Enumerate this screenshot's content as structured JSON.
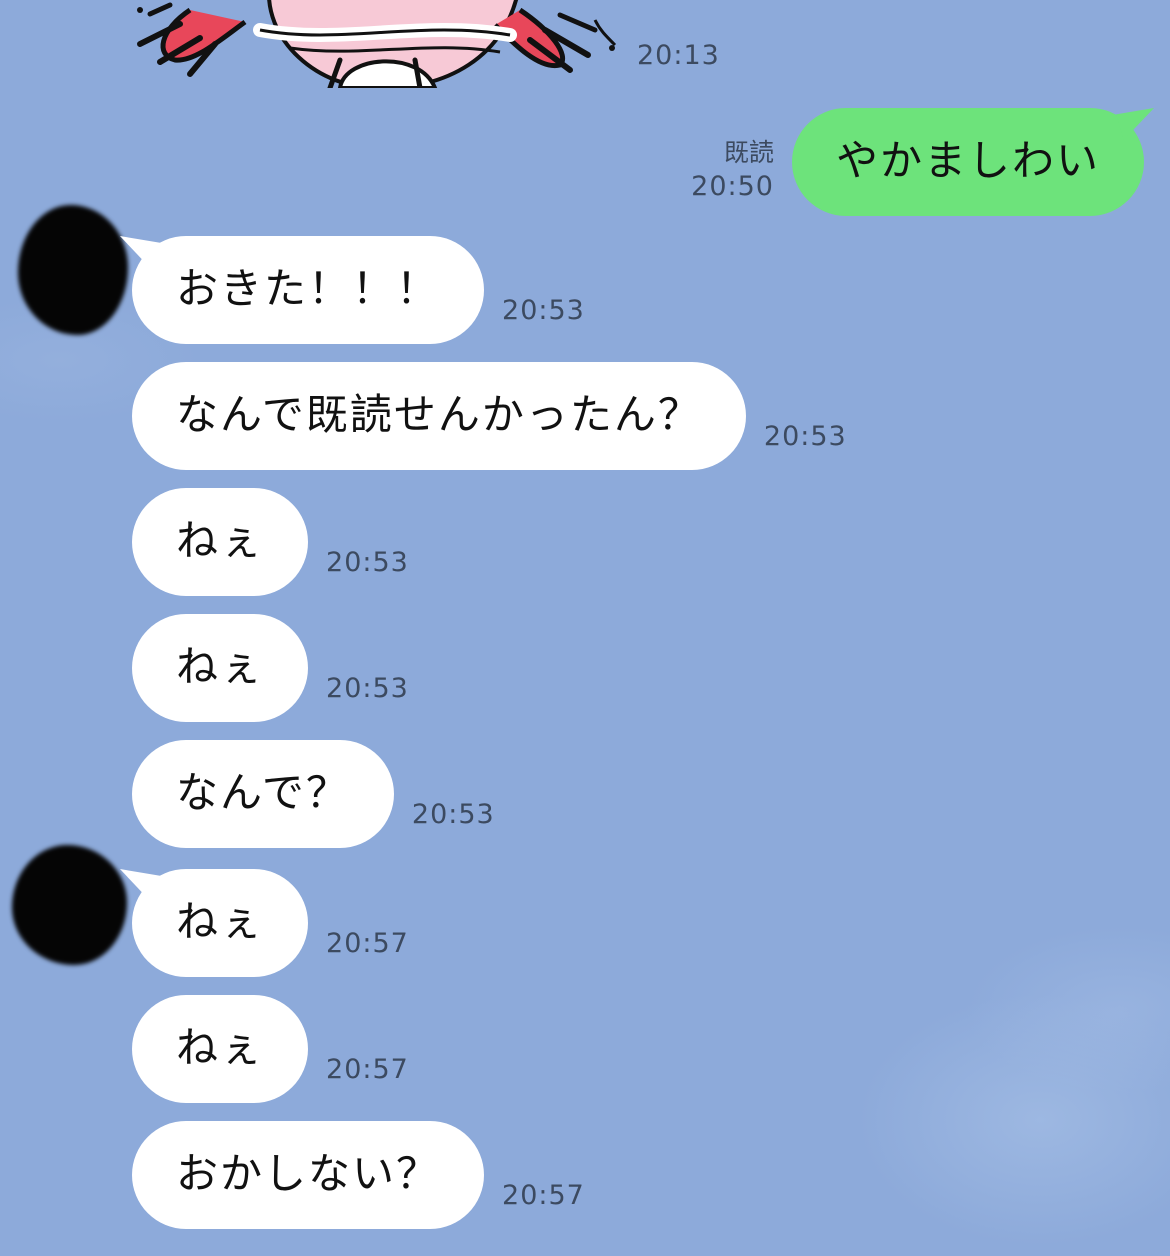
{
  "sticker": {
    "time": "20:13"
  },
  "outgoing": [
    {
      "text": "やかましわい",
      "read_label": "既読",
      "time": "20:50"
    }
  ],
  "incoming": [
    {
      "text": "おきた！！！",
      "time": "20:53"
    },
    {
      "text": "なんで既読せんかったん？",
      "time": "20:53"
    },
    {
      "text": "ねぇ",
      "time": "20:53"
    },
    {
      "text": "ねぇ",
      "time": "20:53"
    },
    {
      "text": "なんで？",
      "time": "20:53"
    },
    {
      "text": "ねぇ",
      "time": "20:57"
    },
    {
      "text": "ねぇ",
      "time": "20:57"
    },
    {
      "text": "おかしない？",
      "time": "20:57"
    }
  ],
  "colors": {
    "background": "#8DAADA",
    "outgoing_bubble": "#6DE37B",
    "incoming_bubble": "#FFFFFF"
  }
}
